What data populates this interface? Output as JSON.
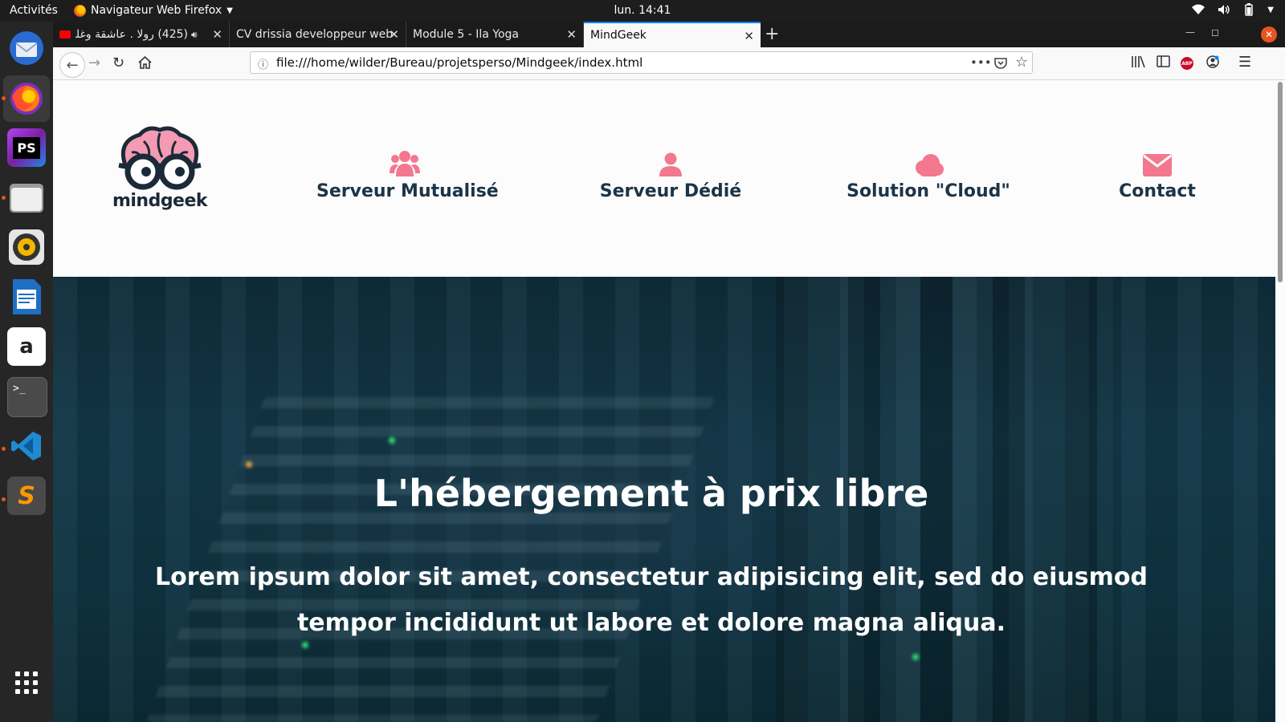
{
  "topbar": {
    "activities": "Activités",
    "app_name": "Navigateur Web Firefox",
    "clock": "lun. 14:41"
  },
  "dock": {
    "items": [
      {
        "name": "thunderbird-icon"
      },
      {
        "name": "firefox-icon"
      },
      {
        "name": "phpstorm-icon",
        "label": "PS"
      },
      {
        "name": "files-icon"
      },
      {
        "name": "rhythmbox-icon"
      },
      {
        "name": "writer-icon"
      },
      {
        "name": "amazon-icon",
        "label": "a"
      },
      {
        "name": "terminal-icon",
        "label": ">_"
      },
      {
        "name": "vscode-icon"
      },
      {
        "name": "sublime-icon",
        "label": "S"
      }
    ]
  },
  "browser": {
    "tabs": [
      {
        "label": "(425) رولا . عاشقة وغلبانة",
        "audio": true
      },
      {
        "label": "CV drissia developpeur web"
      },
      {
        "label": "Module 5 - Ila Yoga"
      },
      {
        "label": "MindGeek",
        "active": true
      }
    ],
    "url": "file:///home/wilder/Bureau/projetsperso/Mindgeek/index.html",
    "abp_label": "ABP"
  },
  "site": {
    "logo_text": "mindgeek",
    "nav": [
      {
        "label": "Serveur Mutualisé",
        "icon": "users-icon"
      },
      {
        "label": "Serveur Dédié",
        "icon": "user-icon"
      },
      {
        "label": "Solution \"Cloud\"",
        "icon": "cloud-icon"
      },
      {
        "label": "Contact",
        "icon": "envelope-icon"
      }
    ],
    "hero": {
      "title": "L'hébergement à prix libre",
      "text": "Lorem ipsum dolor sit amet, consectetur adipisicing elit, sed do eiusmod tempor incididunt ut labore et dolore magna aliqua."
    }
  },
  "colors": {
    "accent_pink": "#f3778f",
    "nav_text": "#1c3447",
    "hero_bg": "#123747",
    "ubuntu_orange": "#e95420"
  }
}
